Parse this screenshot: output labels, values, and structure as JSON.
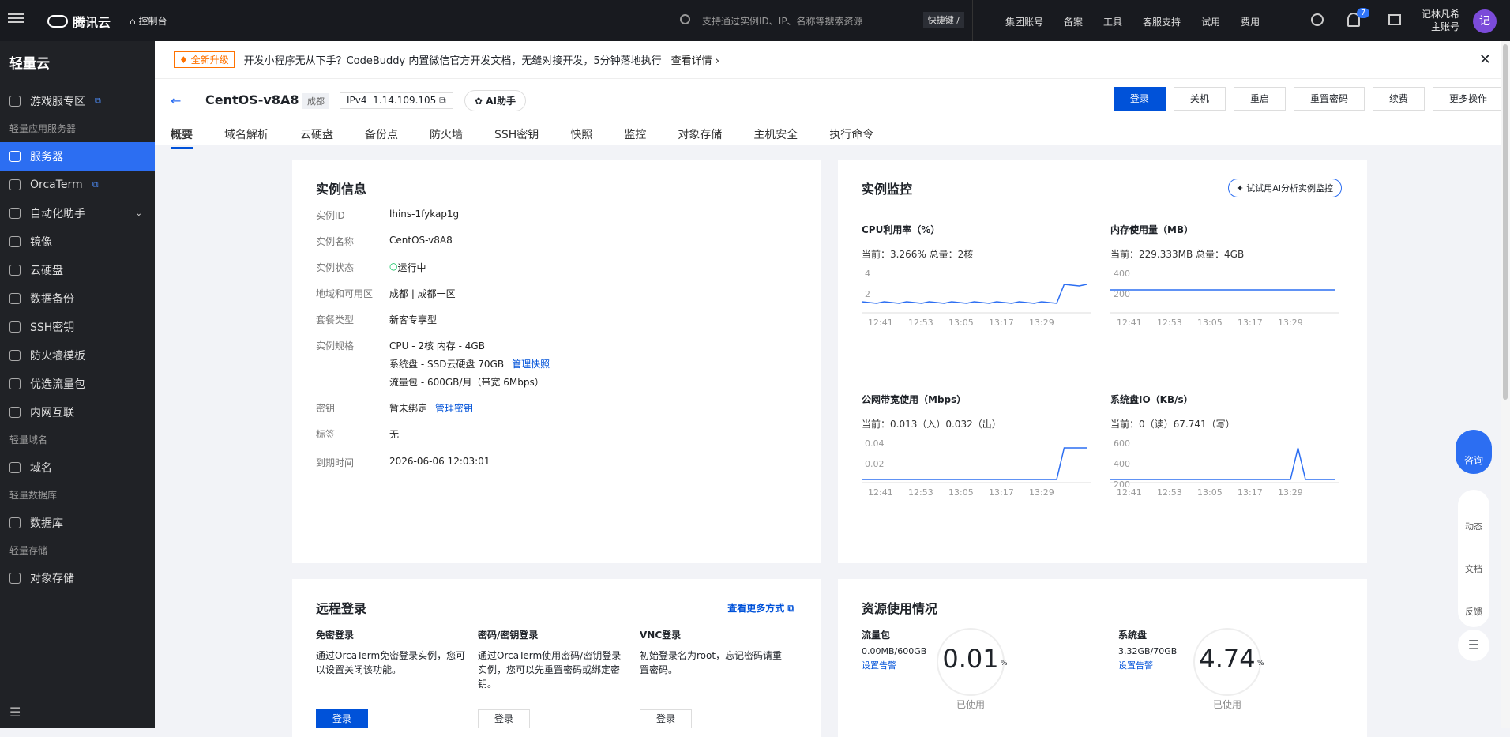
{
  "top": {
    "brand": "腾讯云",
    "console": "控制台",
    "search_placeholder": "支持通过实例ID、IP、名称等搜索资源",
    "shortcut": "快捷键 /",
    "nav": [
      "集团账号",
      "备案",
      "工具",
      "客服支持",
      "试用",
      "费用"
    ],
    "badge": "7",
    "user_name": "记林凡希",
    "user_role": "主账号",
    "avatar": "记"
  },
  "sidebar": {
    "title": "轻量云",
    "items": [
      {
        "label": "游戏服专区",
        "section": false,
        "ext": true
      },
      {
        "label": "轻量应用服务器",
        "section": true
      },
      {
        "label": "服务器",
        "active": true
      },
      {
        "label": "OrcaTerm",
        "ext": true
      },
      {
        "label": "自动化助手",
        "expand": true
      },
      {
        "label": "镜像"
      },
      {
        "label": "云硬盘"
      },
      {
        "label": "数据备份"
      },
      {
        "label": "SSH密钥"
      },
      {
        "label": "防火墙模板"
      },
      {
        "label": "优选流量包"
      },
      {
        "label": "内网互联"
      },
      {
        "label": "轻量域名",
        "section": true
      },
      {
        "label": "域名"
      },
      {
        "label": "轻量数据库",
        "section": true
      },
      {
        "label": "数据库"
      },
      {
        "label": "轻量存储",
        "section": true
      },
      {
        "label": "对象存储"
      }
    ]
  },
  "notice": {
    "tag": "全新升级",
    "text": "开发小程序无从下手？CodeBuddy 内置微信官方开发文档，无缝对接开发，5分钟落地执行",
    "link": "查看详情"
  },
  "header": {
    "name": "CentOS-v8A8",
    "city": "成都",
    "ip_label": "IPv4",
    "ip": "1.14.109.105",
    "ai": "AI助手",
    "buttons": [
      "登录",
      "关机",
      "重启",
      "重置密码",
      "续费",
      "更多操作"
    ],
    "tabs": [
      "概要",
      "域名解析",
      "云硬盘",
      "备份点",
      "防火墙",
      "SSH密钥",
      "快照",
      "监控",
      "对象存储",
      "主机安全",
      "执行命令"
    ]
  },
  "info": {
    "title": "实例信息",
    "rows": [
      {
        "k": "实例ID",
        "v": "lhins-1fykap1g"
      },
      {
        "k": "实例名称",
        "v": "CentOS-v8A8"
      },
      {
        "k": "实例状态",
        "v": "运行中"
      },
      {
        "k": "地域和可用区",
        "v": "成都 | 成都一区"
      },
      {
        "k": "套餐类型",
        "v": "新客专享型"
      },
      {
        "k": "实例规格",
        "v": "CPU - 2核 内存 - 4GB"
      },
      {
        "k": "",
        "v": "系统盘 - SSD云硬盘 70GB",
        "link": "管理快照"
      },
      {
        "k": "",
        "v": "流量包 - 600GB/月（带宽 6Mbps）"
      },
      {
        "k": "密钥",
        "v": "暂未绑定",
        "link": "管理密钥"
      },
      {
        "k": "标签",
        "v": "无"
      },
      {
        "k": "到期时间",
        "v": "2026-06-06 12:03:01"
      }
    ]
  },
  "monitor": {
    "title": "实例监控",
    "ai_btn": "试试用AI分析实例监控",
    "charts": [
      {
        "title": "CPU利用率（%）",
        "cur": "当前：3.266% 总量：2核",
        "yticks": [
          "4",
          "2"
        ],
        "xticks": [
          "12:41",
          "12:53",
          "13:05",
          "13:17",
          "13:29"
        ]
      },
      {
        "title": "内存使用量（MB）",
        "cur": "当前：229.333MB 总量：4GB",
        "yticks": [
          "400",
          "200"
        ],
        "xticks": [
          "12:41",
          "12:53",
          "13:05",
          "13:17",
          "13:29"
        ]
      },
      {
        "title": "公网带宽使用（Mbps）",
        "cur": "当前：0.013（入）0.032（出）",
        "yticks": [
          "0.04",
          "0.02"
        ],
        "xticks": [
          "12:41",
          "12:53",
          "13:05",
          "13:17",
          "13:29"
        ]
      },
      {
        "title": "系统盘IO（KB/s）",
        "cur": "当前：0（读）67.741（写）",
        "yticks": [
          "600",
          "400",
          "200"
        ],
        "xticks": [
          "12:41",
          "12:53",
          "13:05",
          "13:17",
          "13:29"
        ]
      }
    ]
  },
  "remote": {
    "title": "远程登录",
    "more": "查看更多方式",
    "cols": [
      {
        "h": "免密登录",
        "text": "通过OrcaTerm免密登录实例，您可以设置关闭该功能。",
        "btn": "登录"
      },
      {
        "h": "密码/密钥登录",
        "text": "通过OrcaTerm使用密码/密钥登录实例，您可以先重置密码或绑定密钥。",
        "btn": "登录"
      },
      {
        "h": "VNC登录",
        "text": "初始登录名为root，忘记密码请重置密码。",
        "btn": "登录"
      }
    ]
  },
  "usage": {
    "title": "资源使用情况",
    "items": [
      {
        "h": "流量包",
        "v": "0.00MB/600GB",
        "link": "设置告警",
        "pct": "0.01",
        "unit": "%",
        "sub": "已使用"
      },
      {
        "h": "系统盘",
        "v": "3.32GB/70GB",
        "link": "设置告警",
        "pct": "4.74",
        "unit": "%",
        "sub": "已使用"
      }
    ]
  },
  "float": {
    "consult": "咨询",
    "items": [
      "动态",
      "文档",
      "反馈"
    ]
  }
}
